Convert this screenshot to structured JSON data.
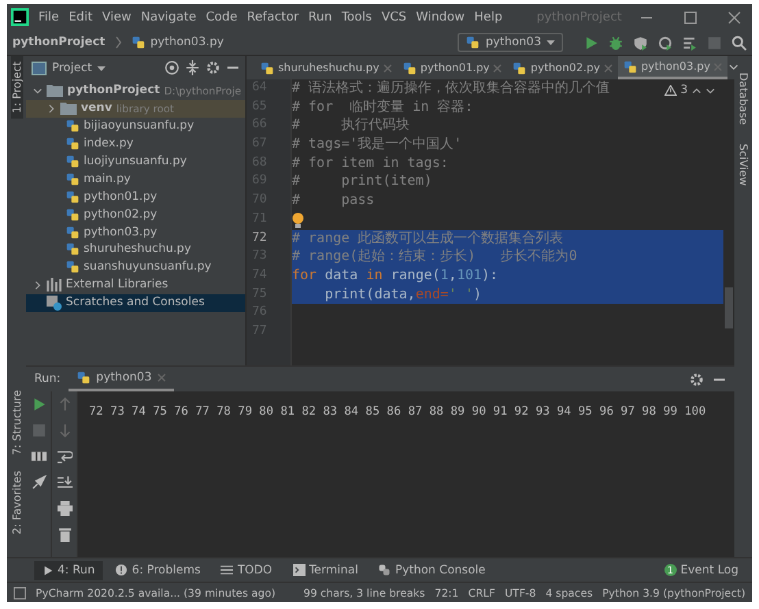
{
  "menu": {
    "items": [
      "File",
      "Edit",
      "View",
      "Navigate",
      "Code",
      "Refactor",
      "Run",
      "Tools",
      "VCS",
      "Window",
      "Help"
    ],
    "window_title": "pythonProject"
  },
  "navbar": {
    "breadcrumb": [
      "pythonProject",
      "python03.py"
    ],
    "run_config": "python03"
  },
  "left_strip": [
    {
      "label": "1: Project",
      "selected": true
    },
    {
      "label": "7: Structure",
      "selected": false
    },
    {
      "label": "2: Favorites",
      "selected": false
    }
  ],
  "right_strip": [
    "Database",
    "SciView"
  ],
  "project_panel": {
    "title": "Project",
    "root": {
      "name": "pythonProject",
      "path": "D:\\pythonProje",
      "expanded": true,
      "children": [
        {
          "name": "venv",
          "note": "library root",
          "kind": "folder",
          "expanded": false
        },
        {
          "name": "bijiaoyunsuanfu.py",
          "kind": "file"
        },
        {
          "name": "index.py",
          "kind": "file"
        },
        {
          "name": "luojiyunsuanfu.py",
          "kind": "file"
        },
        {
          "name": "main.py",
          "kind": "file"
        },
        {
          "name": "python01.py",
          "kind": "file"
        },
        {
          "name": "python02.py",
          "kind": "file"
        },
        {
          "name": "python03.py",
          "kind": "file"
        },
        {
          "name": "shuruheshuchu.py",
          "kind": "file"
        },
        {
          "name": "suanshuyunsuanfu.py",
          "kind": "file"
        }
      ]
    },
    "extras": [
      {
        "name": "External Libraries",
        "kind": "libraries",
        "selected": false
      },
      {
        "name": "Scratches and Consoles",
        "kind": "scratches",
        "selected": true
      }
    ]
  },
  "editor": {
    "tabs": [
      {
        "label": "shuruheshuchu.py",
        "selected": false
      },
      {
        "label": "python01.py",
        "selected": false
      },
      {
        "label": "python02.py",
        "selected": false
      },
      {
        "label": "python03.py",
        "selected": true
      }
    ],
    "warnings": "3",
    "lines": [
      {
        "number": "64",
        "selected": false,
        "current": false,
        "tokens": [
          {
            "kind": "comment",
            "text": "# 语法格式：遍历操作，依次取集合容器中的几个值"
          }
        ]
      },
      {
        "number": "65",
        "selected": false,
        "current": false,
        "tokens": [
          {
            "kind": "comment",
            "text": "# for  临时变量 in 容器:"
          }
        ]
      },
      {
        "number": "66",
        "selected": false,
        "current": false,
        "tokens": [
          {
            "kind": "comment",
            "text": "#     执行代码块"
          }
        ]
      },
      {
        "number": "67",
        "selected": false,
        "current": false,
        "tokens": [
          {
            "kind": "comment",
            "text": "# tags='我是一个中国人'"
          }
        ]
      },
      {
        "number": "68",
        "selected": false,
        "current": false,
        "tokens": [
          {
            "kind": "comment",
            "text": "# for item in tags:"
          }
        ]
      },
      {
        "number": "69",
        "selected": false,
        "current": false,
        "tokens": [
          {
            "kind": "comment",
            "text": "#     print(item)"
          }
        ]
      },
      {
        "number": "70",
        "selected": false,
        "current": false,
        "tokens": [
          {
            "kind": "comment",
            "text": "#     pass"
          }
        ]
      },
      {
        "number": "71",
        "selected": false,
        "current": false,
        "bulb": true
      },
      {
        "number": "72",
        "selected": true,
        "current": true,
        "tokens": [
          {
            "kind": "comment",
            "text": "# range 此函数可以生成一个数据集合列表"
          }
        ]
      },
      {
        "number": "73",
        "selected": true,
        "current": false,
        "tokens": [
          {
            "kind": "comment",
            "text": "# range(起始：结束：步长)   步长不能为0"
          }
        ]
      },
      {
        "number": "74",
        "selected": true,
        "current": false,
        "tokens": [
          {
            "kind": "keyword",
            "text": "for"
          },
          {
            "kind": "plain",
            "text": " data "
          },
          {
            "kind": "keyword",
            "text": "in"
          },
          {
            "kind": "plain",
            "text": " range("
          },
          {
            "kind": "number",
            "text": "1"
          },
          {
            "kind": "plain",
            "text": ","
          },
          {
            "kind": "number",
            "text": "101"
          },
          {
            "kind": "plain",
            "text": "):"
          }
        ]
      },
      {
        "number": "75",
        "selected": true,
        "current": false,
        "tokens": [
          {
            "kind": "plain",
            "text": "    print(data,"
          },
          {
            "kind": "param",
            "text": "end="
          },
          {
            "kind": "string",
            "text": "' '"
          },
          {
            "kind": "plain",
            "text": ")"
          }
        ]
      },
      {
        "number": "76",
        "selected": false,
        "current": false
      },
      {
        "number": "77",
        "selected": false,
        "current": false
      }
    ]
  },
  "run_panel": {
    "label": "Run:",
    "tab": "python03",
    "output": "72 73 74 75 76 77 78 79 80 81 82 83 84 85 86 87 88 89 90 91 92 93 94 95 96 97 98 99 100"
  },
  "bottom_tabs": [
    {
      "label": "4: Run",
      "kind": "run",
      "selected": true
    },
    {
      "label": "6: Problems",
      "kind": "problems",
      "selected": false
    },
    {
      "label": "TODO",
      "kind": "todo",
      "selected": false
    },
    {
      "label": "Terminal",
      "kind": "terminal",
      "selected": false
    },
    {
      "label": "Python Console",
      "kind": "console",
      "selected": false
    }
  ],
  "event_log": {
    "label": "Event Log",
    "badge": "1"
  },
  "status_bar": {
    "message": "PyCharm 2020.2.5 availa... (39 minutes ago)",
    "items": [
      "99 chars, 3 line breaks",
      "72:1",
      "CRLF",
      "UTF-8",
      "4 spaces",
      "Python 3.9 (pythonProject)"
    ]
  }
}
